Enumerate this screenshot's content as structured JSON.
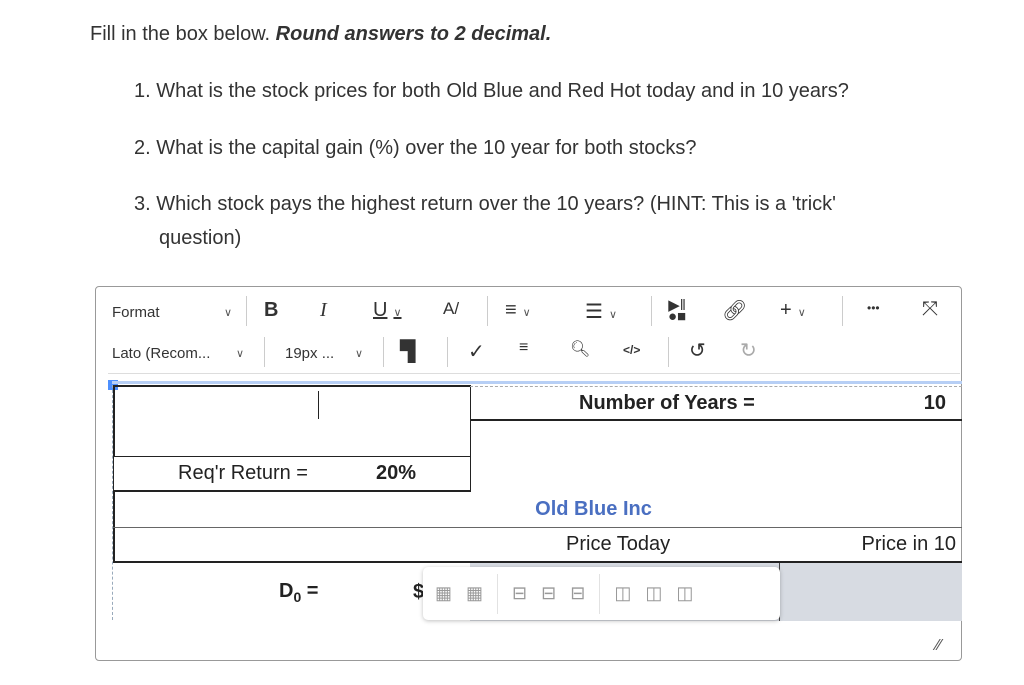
{
  "instructions": {
    "text": "Fill in the box below.",
    "emphasis": "Round answers to 2 decimal."
  },
  "questions": [
    "1. What is the stock prices for both Old Blue and Red Hot today and in 10 years?",
    "2. What is the capital gain (%) over the 10 year for both stocks?",
    "3. Which stock pays the highest return over the 10 years? (HINT: This is a 'trick'",
    "question)"
  ],
  "toolbar": {
    "format": "Format",
    "font": "Lato (Recom...",
    "size": "19px ...",
    "icons": [
      "bold-icon",
      "italic-icon",
      "underline-icon",
      "text-color-icon",
      "align-icon",
      "list-icon",
      "media-icon",
      "link-icon",
      "insert-icon",
      "more-icon",
      "fullscreen-icon",
      "format-painter-icon",
      "spellcheck-icon",
      "word-count-icon",
      "find-replace-icon",
      "source-code-icon",
      "undo-icon",
      "redo-icon"
    ],
    "bold": "B",
    "italic": "I",
    "underline": "U",
    "plus": "+",
    "more": "•••",
    "code": "</>"
  },
  "table": {
    "years_label": "Number of Years =",
    "years_value": "10",
    "return_label": "Req'r Return =",
    "return_value": "20%",
    "company": "Old Blue Inc",
    "company_color": "#4a6fc1",
    "price_today": "Price Today",
    "price_future": "Price in 10",
    "d0_label": "D",
    "d0_sub": "0",
    "d0_eq": " =",
    "dollar": "$"
  }
}
